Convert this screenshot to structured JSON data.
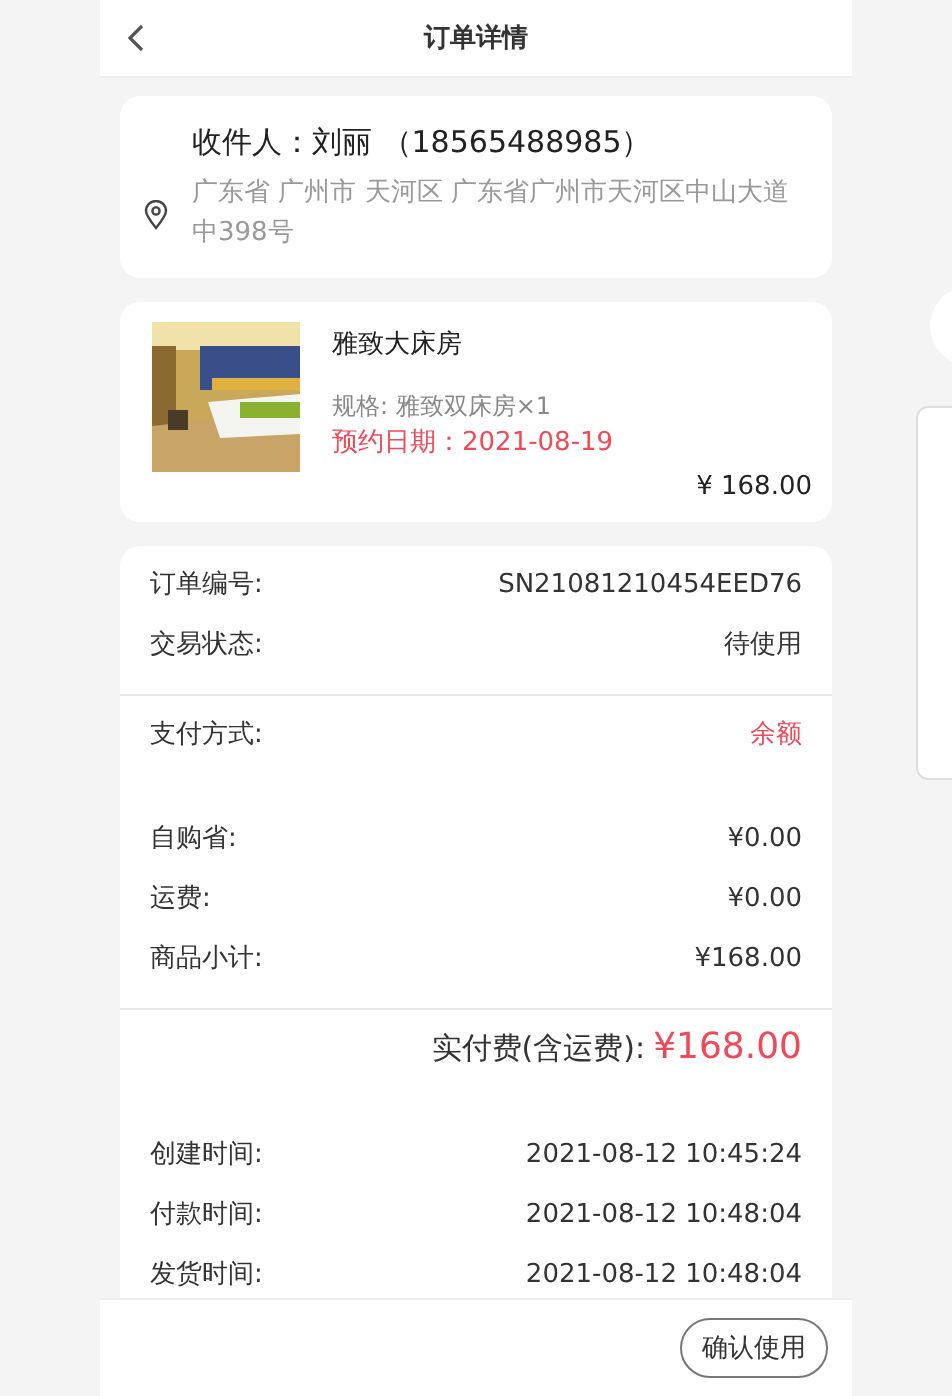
{
  "header": {
    "title": "订单详情"
  },
  "address": {
    "recipient": "收件人：刘丽 （18565488985）",
    "detail": "广东省 广州市 天河区 广东省广州市天河区中山大道中398号"
  },
  "product": {
    "name": "雅致大床房",
    "spec": "规格: 雅致双床房×1",
    "booking_date": "预约日期：2021-08-19",
    "price": "¥ 168.00"
  },
  "order_info": [
    {
      "rows": [
        {
          "label": "订单编号:",
          "value": "SN21081210454EED76",
          "highlight": false
        },
        {
          "label": "交易状态:",
          "value": "待使用",
          "highlight": false
        }
      ]
    },
    {
      "rows": [
        {
          "label": "支付方式:",
          "value": "余额",
          "highlight": true
        }
      ]
    },
    {
      "rows": [
        {
          "label": "自购省:",
          "value": "¥0.00",
          "highlight": false
        },
        {
          "label": "运费:",
          "value": "¥0.00",
          "highlight": false
        },
        {
          "label": "商品小计:",
          "value": "¥168.00",
          "highlight": false
        }
      ]
    }
  ],
  "total": {
    "label": "实付费(含运费):",
    "amount": "¥168.00"
  },
  "times": [
    {
      "label": "创建时间:",
      "value": "2021-08-12 10:45:24"
    },
    {
      "label": "付款时间:",
      "value": "2021-08-12 10:48:04"
    },
    {
      "label": "发货时间:",
      "value": "2021-08-12 10:48:04"
    }
  ],
  "footer": {
    "button": "确认使用"
  }
}
